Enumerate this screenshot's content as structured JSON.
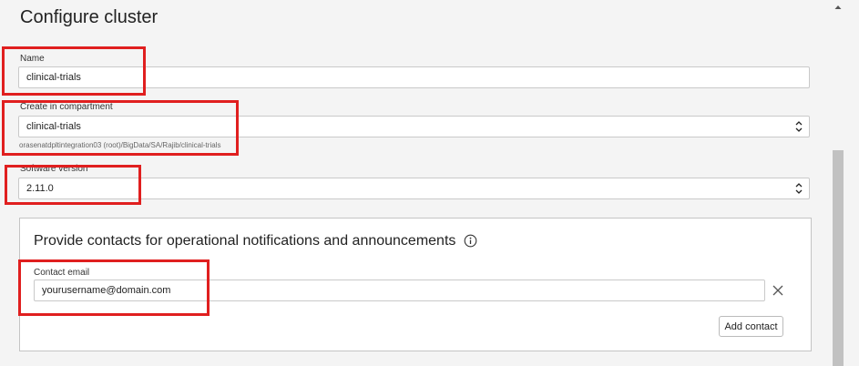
{
  "page": {
    "title": "Configure cluster"
  },
  "name": {
    "label": "Name",
    "value": "clinical-trials"
  },
  "compartment": {
    "label": "Create in compartment",
    "value": "clinical-trials",
    "path": "orasenatdpltintegration03 (root)/BigData/SA/Rajib/clinical-trials"
  },
  "software": {
    "label": "Software version",
    "value": "2.11.0"
  },
  "contacts": {
    "title": "Provide contacts for operational notifications and announcements",
    "email_label": "Contact email",
    "email_value": "yourusername@domain.com",
    "add_contact_label": "Add contact"
  },
  "icons": {
    "select": "up-down-chevron-icon",
    "info": "info-icon",
    "close": "close-icon",
    "scroll_up": "scroll-up-icon"
  },
  "colors": {
    "highlight": "#e01f1f",
    "background": "#f4f4f4"
  }
}
